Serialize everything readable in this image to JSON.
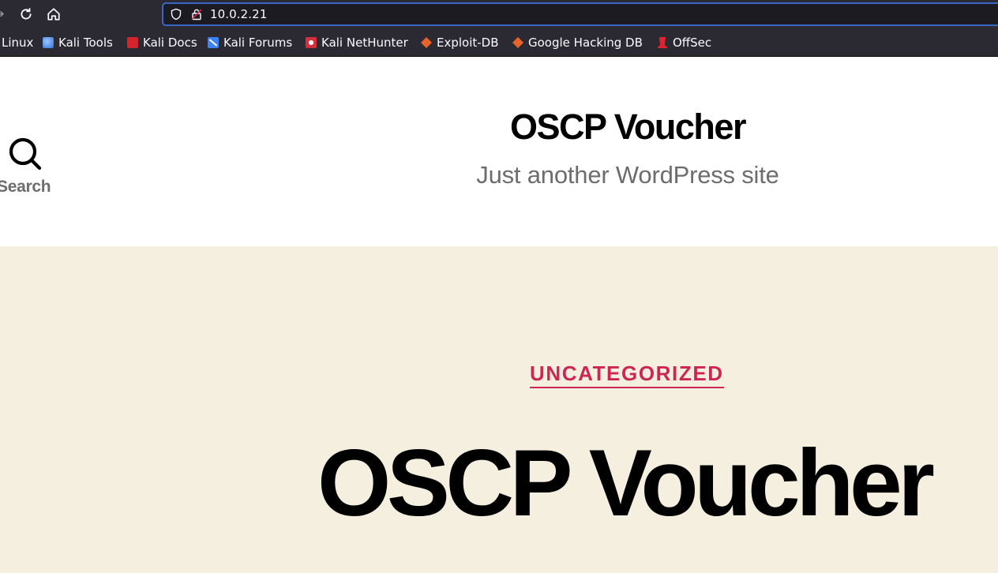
{
  "browser": {
    "url": "10.0.2.21",
    "bookmarks": [
      {
        "label": "Linux",
        "icon": "none"
      },
      {
        "label": "Kali Tools",
        "icon": "kali-tools-icon"
      },
      {
        "label": "Kali Docs",
        "icon": "kali-docs-icon"
      },
      {
        "label": "Kali Forums",
        "icon": "kali-forums-icon"
      },
      {
        "label": "Kali NetHunter",
        "icon": "kali-nethunter-icon"
      },
      {
        "label": "Exploit-DB",
        "icon": "exploit-db-icon"
      },
      {
        "label": "Google Hacking DB",
        "icon": "google-hacking-db-icon"
      },
      {
        "label": "OffSec",
        "icon": "offsec-icon"
      }
    ]
  },
  "header": {
    "search_label": "Search",
    "site_title": "OSCP Voucher",
    "site_description": "Just another WordPress site"
  },
  "post": {
    "category": "UNCATEGORIZED",
    "title": "OSCP Voucher"
  },
  "colors": {
    "toolbar_bg": "#2b2a33",
    "accent": "#cd2653",
    "post_bg": "#f5efe0",
    "secondary_text": "#6d6d6d"
  }
}
